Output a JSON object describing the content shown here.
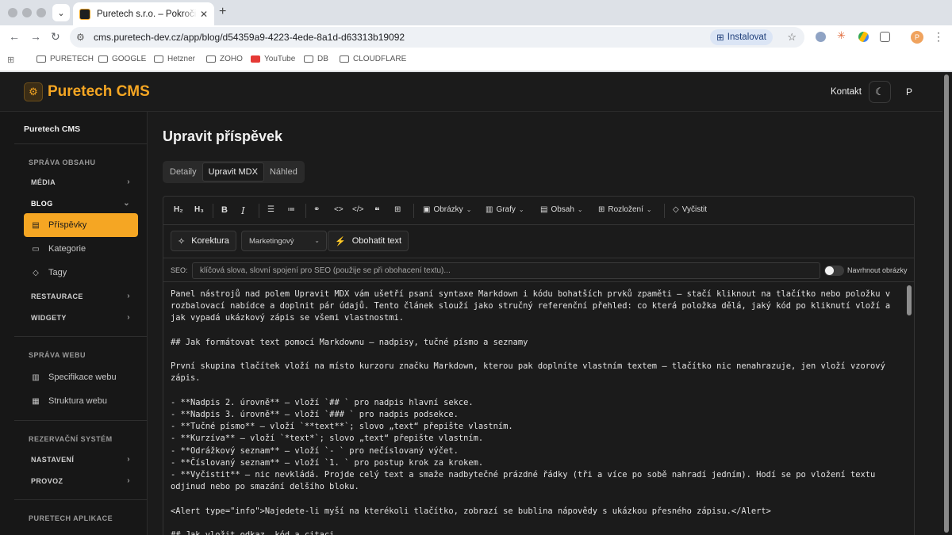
{
  "browser": {
    "tab_title": "Puretech s.r.o. – Pokročilé w…",
    "url": "cms.puretech-dev.cz/app/blog/d54359a9-4223-4ede-8a1d-d63313b19092",
    "install_label": "Instalovat",
    "bookmarks": [
      "PURETECH",
      "GOOGLE",
      "Hetzner",
      "ZOHO",
      "YouTube",
      "DB",
      "CLOUDFLARE"
    ],
    "profile_initial": "P"
  },
  "app": {
    "brand": "Puretech CMS",
    "contact_label": "Kontakt",
    "avatar_initial": "P",
    "accent_color": "#f5a623"
  },
  "sidebar": {
    "title": "Puretech CMS",
    "section_content": "SPRÁVA OBSAHU",
    "group_media": "MÉDIA",
    "group_blog": "BLOG",
    "item_posts": "Příspěvky",
    "item_categories": "Kategorie",
    "item_tags": "Tagy",
    "group_restaurants": "RESTAURACE",
    "group_widgets": "WIDGETY",
    "section_web": "SPRÁVA WEBU",
    "item_web_spec": "Specifikace webu",
    "item_web_structure": "Struktura webu",
    "section_reservation": "REZERVAČNÍ SYSTÉM",
    "group_settings": "NASTAVENÍ",
    "group_operations": "PROVOZ",
    "section_apps": "PURETECH APLIKACE"
  },
  "main": {
    "title": "Upravit příspěvek",
    "tabs": [
      "Detaily",
      "Upravit MDX",
      "Náhled"
    ],
    "active_tab": "Upravit MDX"
  },
  "editor": {
    "toolbar": {
      "h2": "H₂",
      "h3": "H₃",
      "images": "Obrázky",
      "charts": "Grafy",
      "content": "Obsah",
      "layout": "Rozložení",
      "clear": "Vyčistit"
    },
    "ai": {
      "proofread": "Korektura",
      "style": "Marketingový",
      "enrich": "Obohatit text"
    },
    "seo": {
      "label": "SEO:",
      "placeholder": "klíčová slova, slovní spojení pro SEO (použije se při obohacení textu)...",
      "toggle_label": "Navrhnout obrázky",
      "toggle_on": false
    },
    "content": "Panel nástrojů nad polem Upravit MDX vám ušetří psaní syntaxe Markdown i kódu bohatších prvků zpaměti — stačí kliknout na tlačítko nebo položku v rozbalovací nabídce a doplnit pár údajů. Tento článek slouží jako stručný referenční přehled: co která položka dělá, jaký kód po kliknutí vloží a jak vypadá ukázkový zápis se všemi vlastnostmi.\n\n## Jak formátovat text pomocí Markdownu — nadpisy, tučné písmo a seznamy\n\nPrvní skupina tlačítek vloží na místo kurzoru značku Markdown, kterou pak doplníte vlastním textem — tlačítko nic nenahrazuje, jen vloží vzorový zápis.\n\n- **Nadpis 2. úrovně** — vloží `## ` pro nadpis hlavní sekce.\n- **Nadpis 3. úrovně** — vloží `### ` pro nadpis podsekce.\n- **Tučné písmo** — vloží `**text**`; slovo „text“ přepište vlastním.\n- **Kurzíva** — vloží `*text*`; slovo „text“ přepište vlastním.\n- **Odrážkový seznam** — vloží `- ` pro nečíslovaný výčet.\n- **Číslovaný seznam** — vloží `1. ` pro postup krok za krokem.\n- **Vyčistit** — nic nevkládá. Projde celý text a smaže nadbytečné prázdné řádky (tři a více po sobě nahradí jedním). Hodí se po vložení textu odjinud nebo po smazání delšího bloku.\n\n<Alert type=\"info\">Najedete-li myší na kterékoli tlačítko, zobrazí se bublina nápovědy s ukázkou přesného zápisu.</Alert>\n\n## Jak vložit odkaz, kód a citaci"
  }
}
